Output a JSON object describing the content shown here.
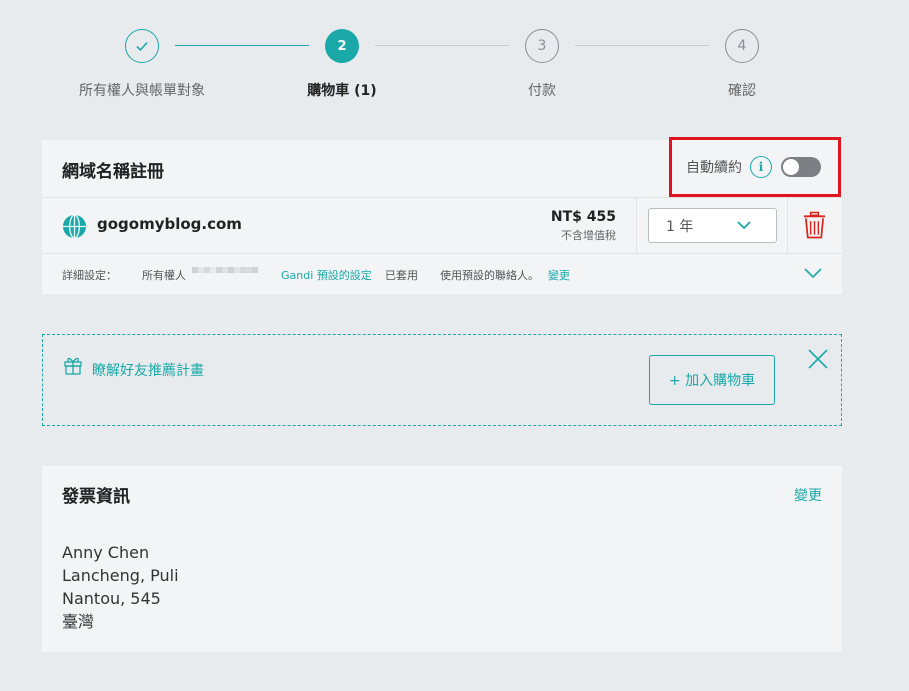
{
  "stepper": {
    "steps": [
      {
        "number": "",
        "label": "所有權人與帳單對象",
        "state": "done"
      },
      {
        "number": "2",
        "label": "購物車 (1)",
        "state": "active"
      },
      {
        "number": "3",
        "label": "付款",
        "state": "pending"
      },
      {
        "number": "4",
        "label": "確認",
        "state": "pending"
      }
    ]
  },
  "domain_card": {
    "title": "網域名稱註冊",
    "auto_renew_label": "自動續約",
    "auto_renew_on": false,
    "info_glyph": "i",
    "domain": "gogomyblog.com",
    "price": "NT$ 455",
    "tax_note": "不含增值稅",
    "period": "1 年",
    "details": {
      "label": "詳細設定：",
      "owner_prefix": "所有權人",
      "gandi_link": "Gandi 預設的設定",
      "applied": "已套用",
      "contact_text": "使用預設的聯絡人。",
      "contact_change": "變更"
    }
  },
  "referral": {
    "text": "瞭解好友推薦計畫",
    "add_button": "+ 加入購物車"
  },
  "invoice": {
    "title": "發票資訊",
    "change": "變更",
    "address": [
      "Anny Chen",
      "Lancheng, Puli",
      "Nantou, 545",
      "臺灣"
    ]
  },
  "colors": {
    "accent": "#1aa8a8",
    "highlight": "#e0141e",
    "delete": "#d9251d",
    "background": "#e8ebee",
    "card": "#f3f4f6"
  },
  "icons": [
    "check-icon",
    "info-icon",
    "globe-icon",
    "chevron-down-icon",
    "trash-icon",
    "gift-icon",
    "close-icon"
  ]
}
